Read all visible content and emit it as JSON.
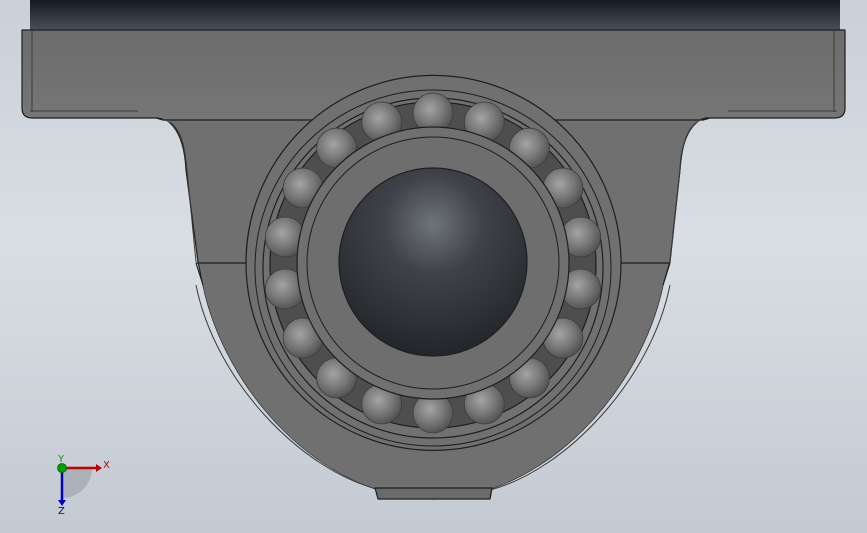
{
  "viewport": {
    "model": "pillow-block-bearing"
  },
  "triad": {
    "x_label": "X",
    "y_label": "Y",
    "z_label": "Z"
  },
  "colors": {
    "housing": "#707070",
    "housing_dark": "#4e4e4e",
    "edge": "#1e1e1e",
    "ball": "#7a7a7a",
    "bore": "#2b2e33",
    "axis_x": "#c00000",
    "axis_y": "#00a000",
    "axis_z": "#0000c0"
  },
  "bearing": {
    "ball_count": 18
  }
}
